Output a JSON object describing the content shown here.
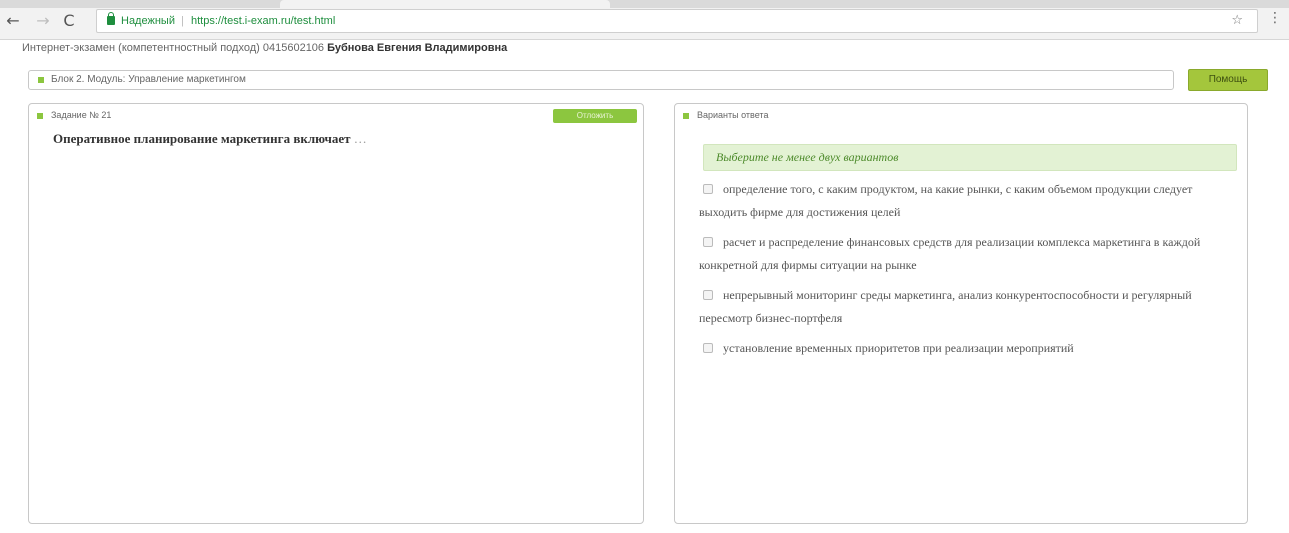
{
  "browser": {
    "secure_label": "Надежный",
    "url": "https://test.i-exam.ru/test.html",
    "back_icon": "←",
    "forward_icon": "→",
    "reload_icon": "C",
    "star_icon": "☆",
    "menu_icon": "⋮"
  },
  "header": {
    "exam_info": "Интернет-экзамен (компетентностный подход) 0415602106",
    "student_name": "Бубнова Евгения Владимировна"
  },
  "block": {
    "label": "Блок 2. Модуль: Управление маркетингом"
  },
  "help_button": {
    "label": "Помощь"
  },
  "task": {
    "title": "Задание № 21",
    "skip_label": "Отложить",
    "question": "Оперативное планирование маркетинга включает",
    "ellipsis": "…"
  },
  "answers": {
    "title": "Варианты ответа",
    "hint": "Выберите не менее двух вариантов",
    "options": [
      {
        "label": "определение того, с каким продуктом, на какие рынки, с каким объемом продукции следует выходить фирме для достижения целей",
        "checked": false
      },
      {
        "label": "расчет и распределение финансовых средств для реализации комплекса маркетинга в каждой конкретной для фирмы ситуации на рынке",
        "checked": false
      },
      {
        "label": "непрерывный мониторинг среды маркетинга, анализ конкурентоспособности и регулярный пересмотр бизнес-портфеля",
        "checked": false
      },
      {
        "label": "установление временных приоритетов при реализации мероприятий",
        "checked": false
      }
    ]
  },
  "colors": {
    "accent_green": "#8cc63f",
    "help_button": "#a4c63c",
    "hint_bg": "#e3f2d4",
    "secure_green": "#1e8e3e"
  }
}
